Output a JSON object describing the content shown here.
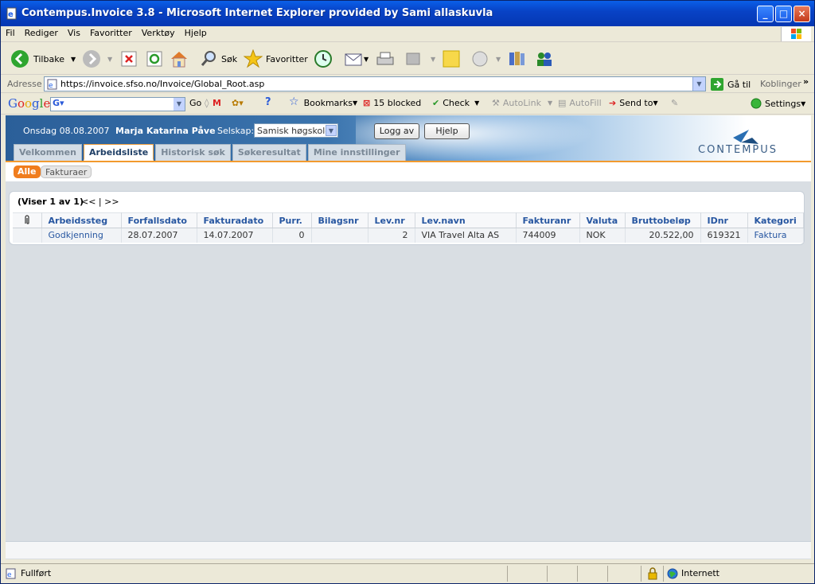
{
  "window": {
    "title": "Contempus.Invoice 3.8 - Microsoft Internet Explorer provided by Sami allaskuvla"
  },
  "menu": [
    "Fil",
    "Rediger",
    "Vis",
    "Favoritter",
    "Verktøy",
    "Hjelp"
  ],
  "toolbar": {
    "back": "Tilbake",
    "search": "Søk",
    "favorites": "Favoritter"
  },
  "address": {
    "label": "Adresse",
    "url": "https://invoice.sfso.no/Invoice/Global_Root.asp",
    "go": "Gå til",
    "links": "Koblinger"
  },
  "google": {
    "logo": "Google",
    "go": "Go",
    "bookmarks": "Bookmarks",
    "blocked": "15 blocked",
    "check": "Check",
    "autolink": "AutoLink",
    "autofill": "AutoFill",
    "sendto": "Send to",
    "settings": "Settings"
  },
  "header": {
    "date": "Onsdag 08.08.2007",
    "user": "Marja Katarina Påve",
    "company_label": "Selskap:",
    "company": "Samisk høgskole",
    "logout": "Logg av",
    "help": "Hjelp",
    "logo": "CONTEMPUS"
  },
  "tabs": [
    "Velkommen",
    "Arbeidsliste",
    "Historisk søk",
    "Søkeresultat",
    "Mine innstillinger"
  ],
  "filters": {
    "all": "Alle",
    "invoices": "Fakturaer"
  },
  "list": {
    "showing": "(Viser 1 av 1)",
    "nav": "<< | >>",
    "columns": [
      "Arbeidssteg",
      "Forfallsdato",
      "Fakturadato",
      "Purr.",
      "Bilagsnr",
      "Lev.nr",
      "Lev.navn",
      "Fakturanr",
      "Valuta",
      "Bruttobeløp",
      "IDnr",
      "Kategori"
    ],
    "rows": [
      {
        "step": "Godkjenning",
        "due": "28.07.2007",
        "invdate": "14.07.2007",
        "reminder": "0",
        "voucher": "",
        "supplier_no": "2",
        "supplier": "VIA Travel Alta AS",
        "invoice_no": "744009",
        "currency": "NOK",
        "gross": "20.522,00",
        "id": "619321",
        "category": "Faktura"
      }
    ]
  },
  "status": {
    "left": "Fullført",
    "zone": "Internett"
  }
}
